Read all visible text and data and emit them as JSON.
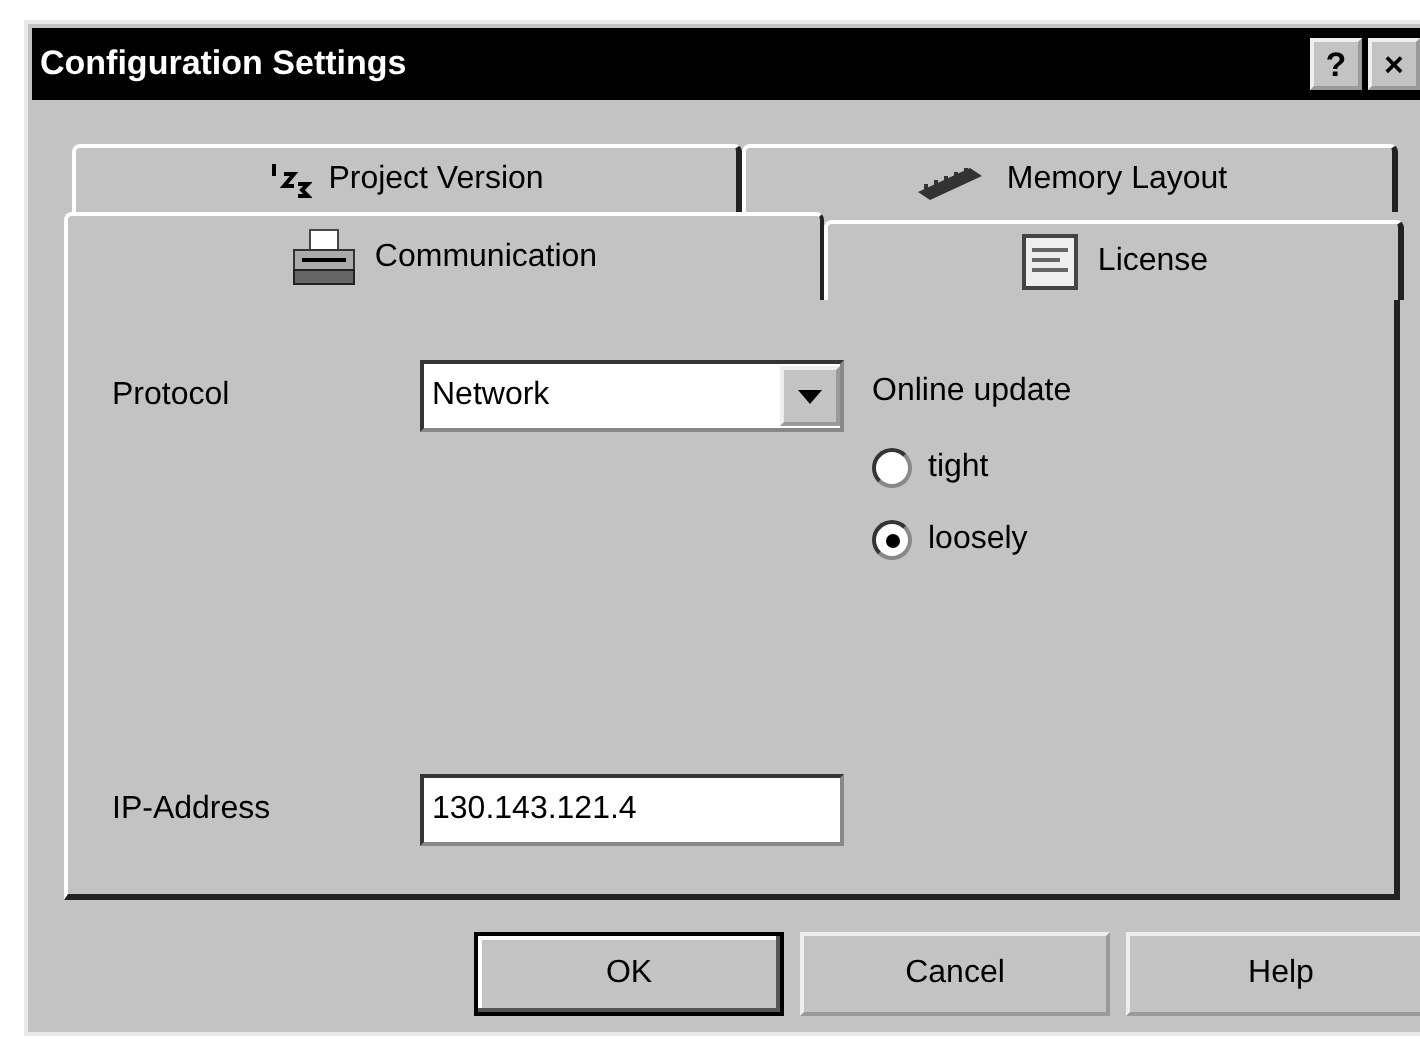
{
  "window": {
    "title": "Configuration Settings",
    "title_buttons": [
      "?",
      "×"
    ]
  },
  "tab_rows": [
    [
      {
        "label": "Project Version",
        "selected": false
      },
      {
        "label": "Memory Layout",
        "selected": false
      }
    ],
    [
      {
        "label": "Communication",
        "selected": true
      },
      {
        "label": "License",
        "selected": false
      }
    ]
  ],
  "protocol": {
    "label": "Protocol",
    "value": "Network"
  },
  "online_update": {
    "label": "Online update",
    "options": [
      {
        "label": "tight",
        "selected": false
      },
      {
        "label": "loosely",
        "selected": true
      }
    ]
  },
  "ip_address": {
    "label": "IP-Address",
    "value": "130.143.121.4"
  },
  "buttons": [
    {
      "label": "OK",
      "default": true
    },
    {
      "label": "Cancel",
      "default": false
    },
    {
      "label": "Help",
      "default": false
    }
  ]
}
